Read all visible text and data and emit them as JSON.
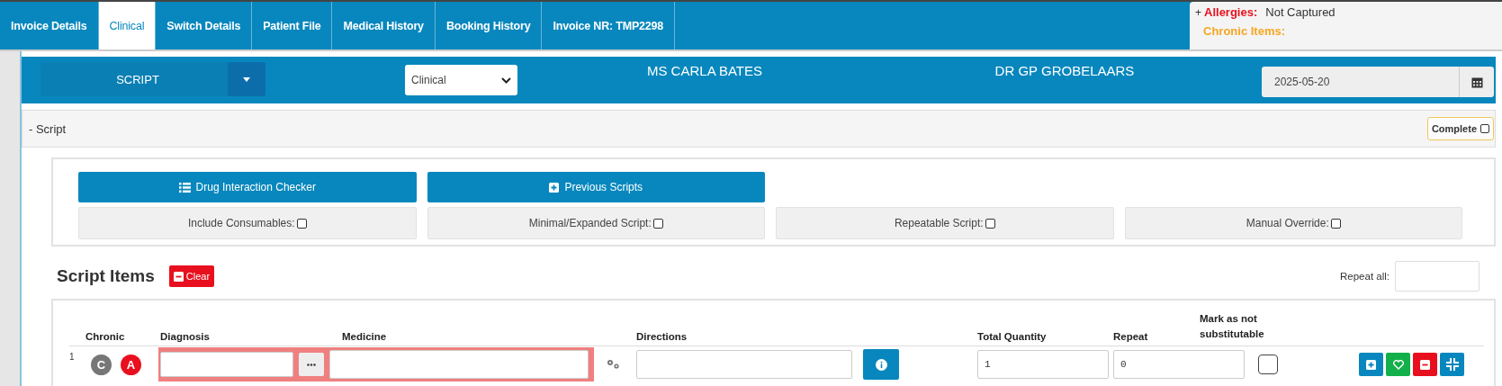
{
  "tabs": [
    {
      "label": "Invoice Details",
      "selected": false
    },
    {
      "label": "Clinical",
      "selected": true
    },
    {
      "label": "Switch Details",
      "selected": false
    },
    {
      "label": "Patient File",
      "selected": false
    },
    {
      "label": "Medical History",
      "selected": false
    },
    {
      "label": "Booking History",
      "selected": false
    },
    {
      "label": "Invoice NR: TMP2298",
      "selected": false
    }
  ],
  "alerts": {
    "toggle": "+",
    "allergies_label": "Allergies:",
    "allergies_value": "Not Captured",
    "chronic_label": "Chronic Items:"
  },
  "header": {
    "mode": "SCRIPT",
    "type_select": "Clinical",
    "patient": "MS CARLA BATES",
    "doctor": "DR GP GROBELAARS",
    "date": "2025-05-20"
  },
  "section": {
    "toggle": "-",
    "title": "Script",
    "complete_label": "Complete",
    "complete_checked": false
  },
  "actions": [
    {
      "label": "Drug Interaction Checker",
      "kind": "list"
    },
    {
      "label": "Previous Scripts",
      "kind": "plus"
    }
  ],
  "options": [
    {
      "label": "Include Consumables:",
      "checked": false
    },
    {
      "label": "Minimal/Expanded Script:",
      "checked": false
    },
    {
      "label": "Repeatable Script:",
      "checked": false
    },
    {
      "label": "Manual Override:",
      "checked": false
    }
  ],
  "script_items": {
    "title": "Script Items",
    "clear_label": "Clear",
    "repeat_all_label": "Repeat all:"
  },
  "table": {
    "columns": [
      "Chronic",
      "Diagnosis",
      "Medicine",
      "Directions",
      "Total Quantity",
      "Repeat",
      "Mark as not substitutable"
    ],
    "rows": [
      {
        "number": "1",
        "badges": [
          {
            "label": "C",
            "color": "#777777"
          },
          {
            "label": "A",
            "color": "#e8101e"
          }
        ],
        "invalid": true,
        "total_quantity": "1",
        "repeat": "0",
        "not_substitutable": false
      }
    ]
  }
}
